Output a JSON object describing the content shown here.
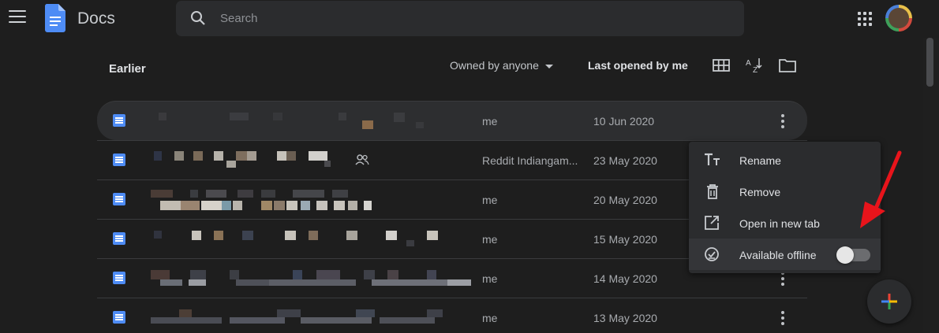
{
  "header": {
    "app_name": "Docs",
    "search_placeholder": "Search"
  },
  "toolbar": {
    "section_title": "Earlier",
    "owner_filter": "Owned by anyone",
    "sort_label": "Last opened by me"
  },
  "files": [
    {
      "owner": "me",
      "date": "10 Jun 2020",
      "shared": false
    },
    {
      "owner": "Reddit Indiangam...",
      "date": "23 May 2020",
      "shared": true
    },
    {
      "owner": "me",
      "date": "20 May 2020",
      "shared": false
    },
    {
      "owner": "me",
      "date": "15 May 2020",
      "shared": false
    },
    {
      "owner": "me",
      "date": "14 May 2020",
      "shared": false
    },
    {
      "owner": "me",
      "date": "13 May 2020",
      "shared": false
    }
  ],
  "context_menu": {
    "items": [
      {
        "label": "Rename",
        "icon": "text-format-icon"
      },
      {
        "label": "Remove",
        "icon": "trash-icon"
      },
      {
        "label": "Open in new tab",
        "icon": "open-in-new-icon"
      },
      {
        "label": "Available offline",
        "icon": "offline-check-icon"
      }
    ],
    "offline_enabled": false
  },
  "colors": {
    "background": "#1e1e1e",
    "doc_icon": "#4e8cf5",
    "annotation_arrow": "#e8141b"
  }
}
